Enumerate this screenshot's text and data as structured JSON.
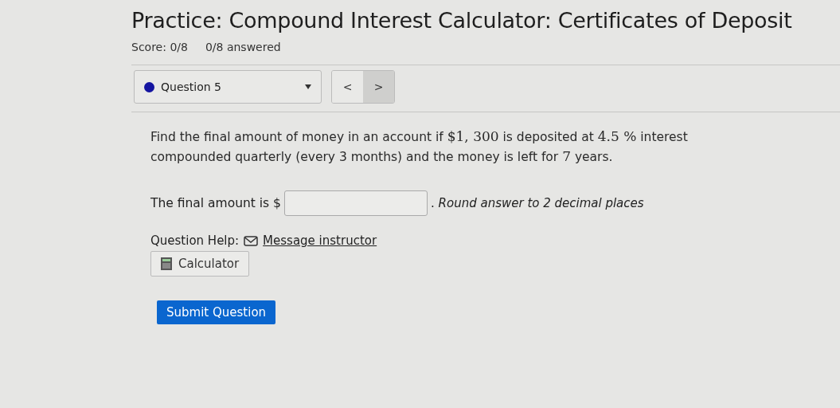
{
  "title": "Practice: Compound Interest Calculator: Certificates of Deposit",
  "score": "Score: 0/8",
  "answered": "0/8 answered",
  "question_select": {
    "label": "Question 5",
    "prev": "<",
    "next": ">"
  },
  "question": {
    "parts": [
      {
        "text": "Find the final amount of money in an account if ",
        "kind": "text"
      },
      {
        "text": "$1, 300",
        "kind": "math"
      },
      {
        "text": " is deposited at ",
        "kind": "text"
      },
      {
        "text": "4.5 %",
        "kind": "math"
      },
      {
        "text": " interest compounded quarterly (every 3 months) and the money is left for ",
        "kind": "text"
      },
      {
        "text": "7",
        "kind": "math"
      },
      {
        "text": " years.",
        "kind": "text"
      }
    ]
  },
  "answer": {
    "label": "The final amount is $",
    "hint": ". *Round answer to 2 decimal places*"
  },
  "help": {
    "label": "Question Help:",
    "link": "Message instructor",
    "calculator": "Calculator"
  },
  "submit": "Submit Question"
}
